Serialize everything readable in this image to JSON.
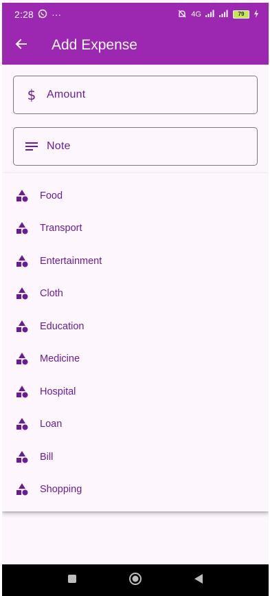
{
  "status_bar": {
    "time": "2:28",
    "more": "···",
    "network": "4G",
    "battery": "79"
  },
  "app_bar": {
    "title": "Add Expense",
    "back_icon": "arrow-back-icon"
  },
  "form": {
    "amount_label": "Amount",
    "amount_icon": "dollar-icon",
    "note_label": "Note",
    "note_icon": "notes-icon"
  },
  "category_menu": {
    "item_icon": "category-shapes-icon",
    "items": [
      {
        "label": "Food"
      },
      {
        "label": "Transport"
      },
      {
        "label": "Entertainment"
      },
      {
        "label": "Cloth"
      },
      {
        "label": "Education"
      },
      {
        "label": "Medicine"
      },
      {
        "label": "Hospital"
      },
      {
        "label": "Loan"
      },
      {
        "label": "Bill"
      },
      {
        "label": "Shopping"
      }
    ]
  },
  "colors": {
    "primary": "#9c27b0",
    "on_surface_label": "#6a1b9a",
    "surface": "#fdf7fd",
    "outline": "#7b757f"
  }
}
